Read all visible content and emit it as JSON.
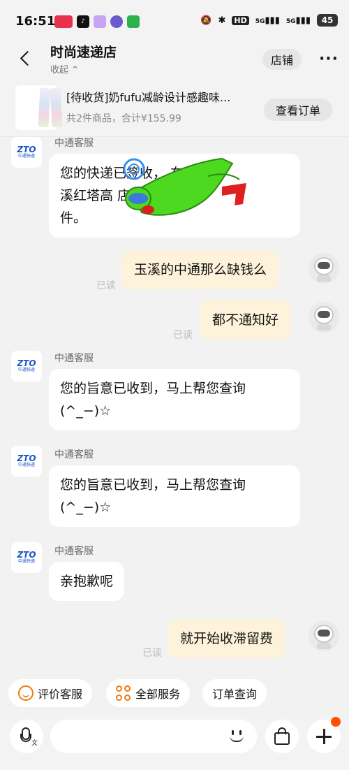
{
  "status_bar": {
    "time": "16:51",
    "network_hd": "HD",
    "signal_1": "5G",
    "signal_2": "5G",
    "battery": "45"
  },
  "header": {
    "shop_name": "时尚速递店",
    "collapse_label": "收起 ⌃",
    "shop_button": "店铺"
  },
  "order": {
    "title": "[待收货]奶fufu减龄设计感趣味...",
    "summary": "共2件商品，合计¥155.99",
    "view_order_button": "查看订单"
  },
  "chat": {
    "messages": [
      {
        "sender": "中通客服",
        "text_lines": [
          "您的快递已签收，    在【玉",
          "溪红塔高                 店】取",
          "件。"
        ]
      },
      {
        "text": "玉溪的中通那么缺钱么",
        "read": "已读"
      },
      {
        "text": "都不通知好",
        "read": "已读"
      },
      {
        "sender": "中通客服",
        "text_lines": [
          "您的旨意已收到，马上帮您查询",
          "(^_−)☆"
        ]
      },
      {
        "sender": "中通客服",
        "text_lines": [
          "您的旨意已收到，马上帮您查询",
          "(^_−)☆"
        ]
      },
      {
        "sender": "中通客服",
        "text_lines": [
          "亲抱歉呢"
        ]
      },
      {
        "text": "就开始收滞留费",
        "read": "已读"
      }
    ],
    "service_logo": {
      "brand": "ZTO",
      "name_cn": "中通快递"
    }
  },
  "quick_actions": {
    "rate": "评价客服",
    "all_services": "全部服务",
    "order_query": "订单查询"
  },
  "input": {
    "voice_label": "文",
    "placeholder": ""
  },
  "colors": {
    "accent": "#f07a10",
    "bubble_out": "#fdf3da",
    "badge": "#ff5000"
  }
}
